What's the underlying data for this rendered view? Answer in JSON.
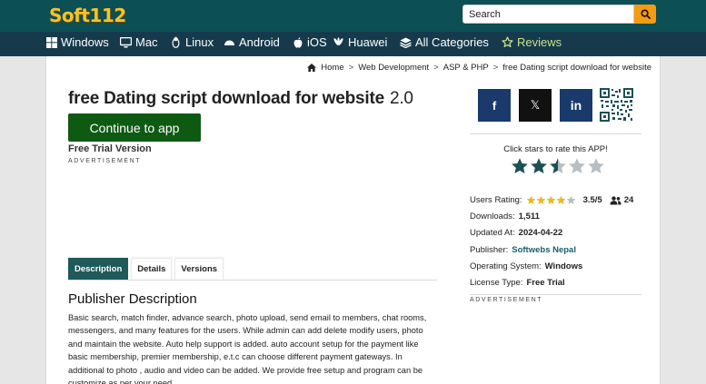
{
  "header": {
    "logo_text": "Soft112",
    "search": {
      "placeholder": "Search",
      "value": ""
    }
  },
  "nav": {
    "items": [
      {
        "label": "Windows",
        "icon": "windows-icon"
      },
      {
        "label": "Mac",
        "icon": "monitor-icon"
      },
      {
        "label": "Linux",
        "icon": "linux-icon"
      },
      {
        "label": "Android",
        "icon": "android-icon"
      },
      {
        "label": "iOS",
        "icon": "apple-icon"
      },
      {
        "label": "Huawei",
        "icon": "huawei-icon"
      },
      {
        "label": "All Categories",
        "icon": "layers-icon"
      },
      {
        "label": "Reviews",
        "icon": "star-outline-icon"
      }
    ]
  },
  "breadcrumb": {
    "items": [
      "Home",
      "Web Development",
      "ASP & PHP",
      "free Dating script download for website"
    ],
    "separator": ">"
  },
  "app": {
    "title": "free Dating script download for website",
    "version": "2.0",
    "continue_label": "Continue to app",
    "license_label": "Free Trial Version",
    "ad_label": "ADVERTISEMENT"
  },
  "tabs": [
    {
      "label": "Description",
      "active": true
    },
    {
      "label": "Details",
      "active": false
    },
    {
      "label": "Versions",
      "active": false
    }
  ],
  "description": {
    "heading": "Publisher Description",
    "text": "Basic search, match finder, advance search, photo upload, send email to members, chat rooms, messengers, and many features for the users. While admin can add delete modify users, photo and maintain the website. Auto help support is added. auto account setup for the payment like basic membership, premier membership, e.t.c can choose different payment gateways. In additional to photo , audio and video can be added. We provide free setup and program can be customize as per your need."
  },
  "share": {
    "facebook": "f",
    "x": "𝕏",
    "linkedin": "in"
  },
  "rating": {
    "prompt": "Click stars to rate this APP!",
    "stars_value": 2.5,
    "max_stars": 5
  },
  "info": {
    "users_rating_label": "Users Rating:",
    "users_rating_value": "3.5/5",
    "users_rating_stars": 4,
    "users_count": "24",
    "downloads_label": "Downloads:",
    "downloads_value": "1,511",
    "updated_label": "Updated At:",
    "updated_value": "2024-04-22",
    "publisher_label": "Publisher:",
    "publisher_value": "Softwebs Nepal",
    "os_label": "Operating System:",
    "os_value": "Windows",
    "license_label": "License Type:",
    "license_value": "Free Trial",
    "ad_label": "ADVERTISEMENT"
  },
  "colors": {
    "topbar": "#0c4f54",
    "navbar": "#163a4c",
    "accent_orange": "#f39c12",
    "continue_green": "#0f5a12",
    "tab_active": "#1f5959",
    "star_filled": "#1d4f57",
    "star_empty": "#b8bec2",
    "mini_star": "#e8b923"
  }
}
